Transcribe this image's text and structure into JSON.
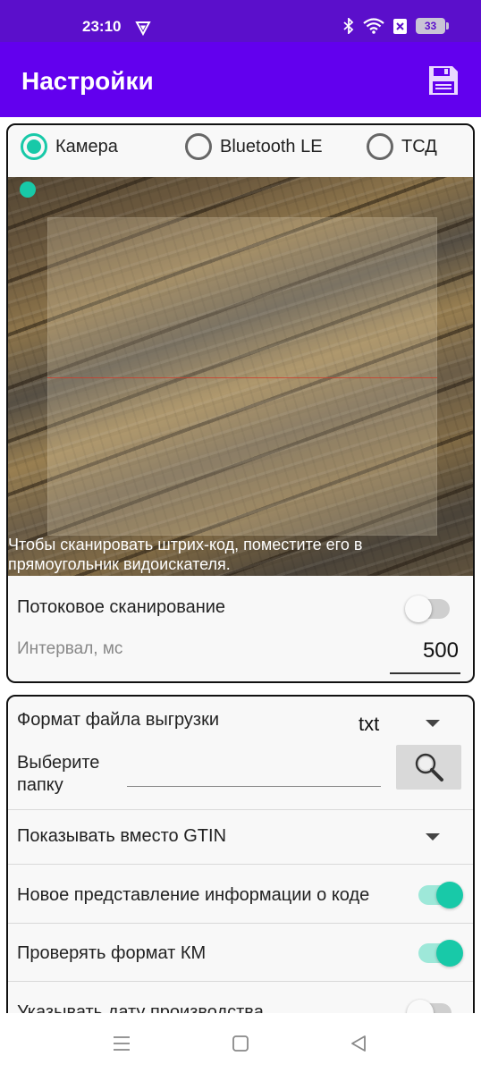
{
  "status_bar": {
    "time": "23:10",
    "battery": "33"
  },
  "app_bar": {
    "title": "Настройки"
  },
  "scanner_source": {
    "options": [
      "Камера",
      "Bluetooth LE",
      "ТСД"
    ],
    "selected": "Камера"
  },
  "camera": {
    "hint": "Чтобы сканировать штрих-код, поместите его в прямоугольник видоискателя."
  },
  "streaming": {
    "label": "Потоковое сканирование",
    "enabled": false
  },
  "interval": {
    "label": "Интервал, мс",
    "value": "500"
  },
  "export": {
    "format_label": "Формат файла выгрузки",
    "format_value": "txt",
    "folder_label": "Выберите папку"
  },
  "gtin": {
    "label": "Показывать вместо GTIN"
  },
  "toggles": [
    {
      "label": "Новое представление информации о коде",
      "enabled": true
    },
    {
      "label": "Проверять формат КМ",
      "enabled": true
    },
    {
      "label": "Указывать дату производства",
      "enabled": false
    }
  ],
  "colors": {
    "status_bar": "#5b0fcb",
    "app_bar": "#6200ee",
    "accent": "#18c9a8"
  }
}
